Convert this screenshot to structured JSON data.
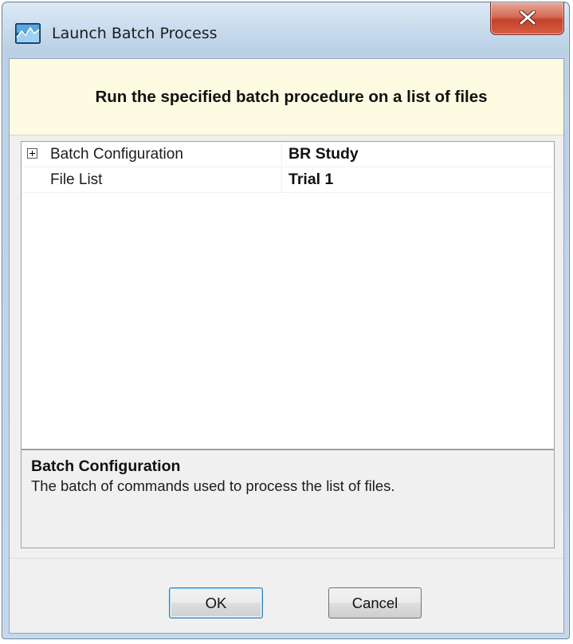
{
  "window": {
    "title": "Launch Batch Process",
    "app_icon": "batch-app-icon",
    "close_icon": "close-x-icon"
  },
  "header": {
    "text": "Run the specified batch procedure on a list of files"
  },
  "properties": [
    {
      "name": "Batch Configuration",
      "value": "BR Study",
      "expandable": true
    },
    {
      "name": "File List",
      "value": "Trial 1",
      "expandable": false
    }
  ],
  "description": {
    "title": "Batch Configuration",
    "text": "The batch of commands used to process the list of files."
  },
  "buttons": {
    "ok_label": "OK",
    "cancel_label": "Cancel"
  },
  "colors": {
    "header_bg": "#fdfce2",
    "close_red": "#c4422b",
    "ok_focus": "#3c7fb1"
  }
}
